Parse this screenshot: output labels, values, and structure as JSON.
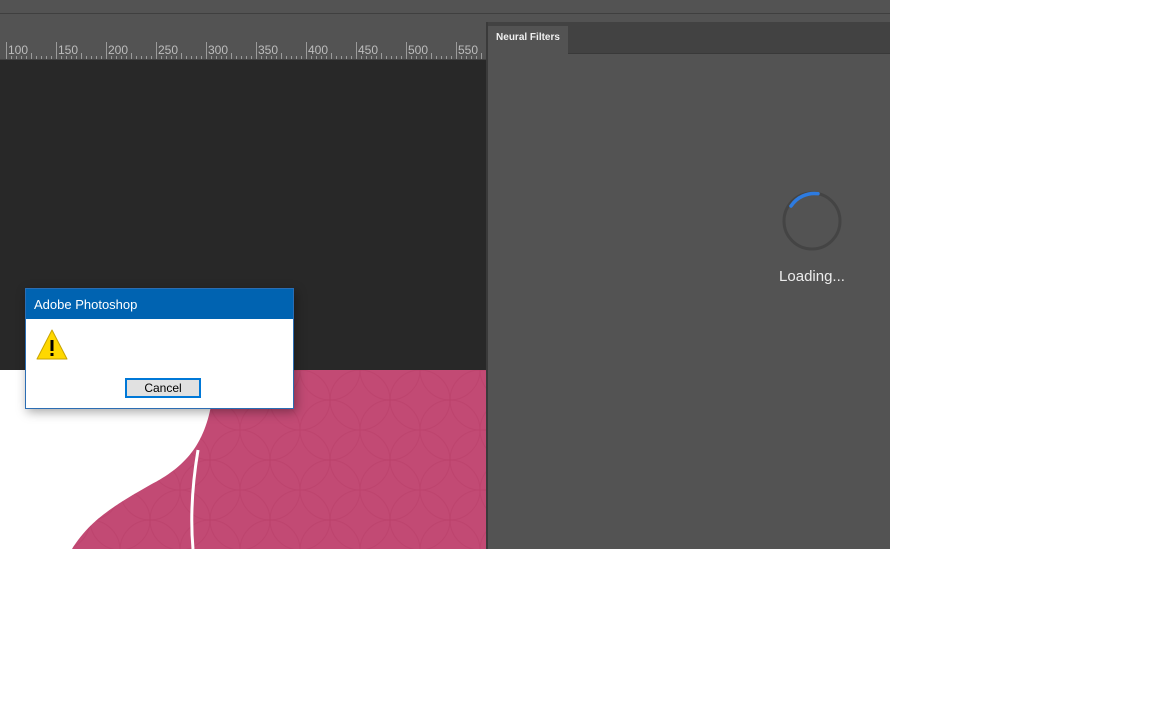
{
  "ruler": {
    "labels": [
      "100",
      "150",
      "200",
      "250",
      "300",
      "350",
      "400",
      "450",
      "500",
      "550"
    ]
  },
  "panel": {
    "tab_label": "Neural Filters",
    "loading_text": "Loading...",
    "spinner_color": "#2d7be0"
  },
  "dialog": {
    "title": "Adobe Photoshop",
    "icon": "warning-icon",
    "cancel_label": "Cancel"
  },
  "colors": {
    "canvas": "#282828",
    "panel": "#535353",
    "dialog_titlebar": "#0063b1",
    "artwork_pink": "#c24a74"
  }
}
